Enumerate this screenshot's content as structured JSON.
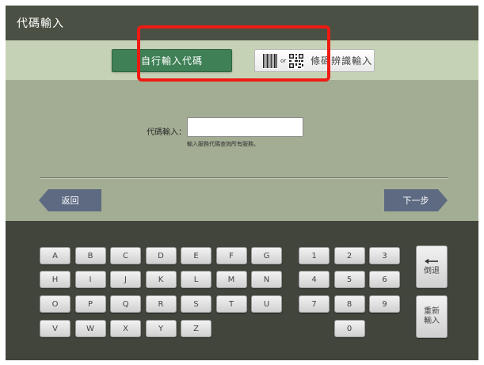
{
  "header": {
    "title": "代碼輸入"
  },
  "tabs": {
    "manual_label": "自行輸入代碼",
    "barcode_or": "or",
    "barcode_label": "條碼辨識輸入",
    "barcode_icon": "barcode-icon",
    "qrcode_icon": "qrcode-icon"
  },
  "form": {
    "code_label": "代碼輸入：",
    "code_value": "",
    "hint": "輸入服務代碼查詢所有服務。",
    "highlight_color": "#ee1b14"
  },
  "nav": {
    "back_label": "返回",
    "next_label": "下一步"
  },
  "keyboard": {
    "letter_rows": [
      [
        "A",
        "B",
        "C",
        "D",
        "E",
        "F",
        "G"
      ],
      [
        "H",
        "I",
        "J",
        "K",
        "L",
        "M",
        "N"
      ],
      [
        "O",
        "P",
        "Q",
        "R",
        "S",
        "T",
        "U"
      ],
      [
        "V",
        "W",
        "X",
        "Y",
        "Z"
      ]
    ],
    "number_rows": [
      [
        "1",
        "2",
        "3"
      ],
      [
        "4",
        "5",
        "6"
      ],
      [
        "7",
        "8",
        "9"
      ],
      [
        "0"
      ]
    ],
    "backspace_icon": "backspace-arrow-icon",
    "backspace_label": "倒退",
    "reset_label_1": "重新",
    "reset_label_2": "輸入"
  }
}
